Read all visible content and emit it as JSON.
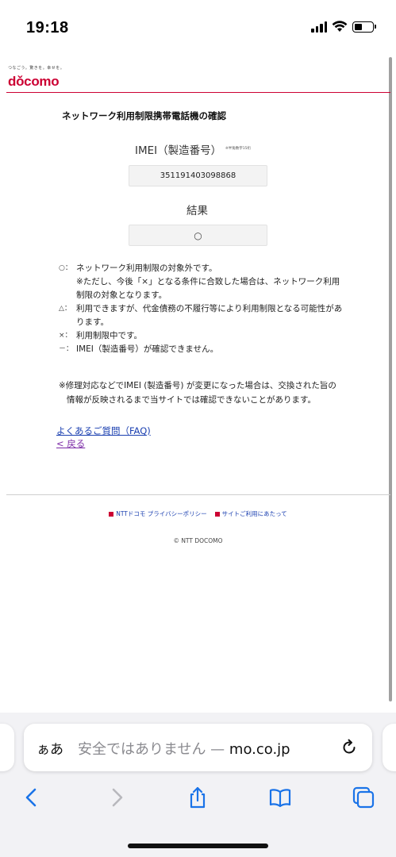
{
  "status_bar": {
    "time": "19:18"
  },
  "header": {
    "tagline": "つなごう。驚きを。幸せを。",
    "logo": "dǒcomo",
    "page_title": "ネットワーク利用制限携帯電話機の確認"
  },
  "form": {
    "imei_label": "IMEI（製造番号）",
    "imei_note": "※半角数字15桁",
    "imei_value": "351191403098868",
    "result_label": "結果",
    "result_value": "○"
  },
  "legend": {
    "items": [
      {
        "symbol": "○：",
        "text": "ネットワーク利用制限の対象外です。"
      },
      {
        "sub": "※ただし、今後「×」となる条件に合致した場合は、ネットワーク利用制限の対象となります。"
      },
      {
        "symbol": "△：",
        "text": "利用できますが、代金債務の不履行等により利用制限となる可能性があります。"
      },
      {
        "symbol": "×：",
        "text": "利用制限中です。"
      },
      {
        "symbol": "－：",
        "text": "IMEI（製造番号）が確認できません。"
      }
    ]
  },
  "notice": "※修理対応などでIMEI (製造番号) が変更になった場合は、交換された旨の情報が反映されるまで当サイトでは確認できないことがあります。",
  "links": {
    "faq": "よくあるご質問（FAQ)",
    "back": "< 戻る"
  },
  "footer": {
    "privacy": "NTTドコモ プライバシーポリシー",
    "terms": "サイトご利用にあたって",
    "copyright": "© NTT DOCOMO"
  },
  "browser": {
    "aa_label": "ぁあ",
    "address_prefix": "安全ではありません — ",
    "address_domain": "mo.co.jp"
  },
  "icons": {
    "back": "chevron-left-icon",
    "forward": "chevron-right-icon",
    "share": "share-icon",
    "bookmarks": "book-icon",
    "tabs": "tabs-icon",
    "reload": "reload-icon"
  },
  "colors": {
    "brand_red": "#cc0033",
    "link_blue": "#1a3fb0",
    "visited_purple": "#7b2aa6",
    "ios_blue": "#1a73e8"
  }
}
